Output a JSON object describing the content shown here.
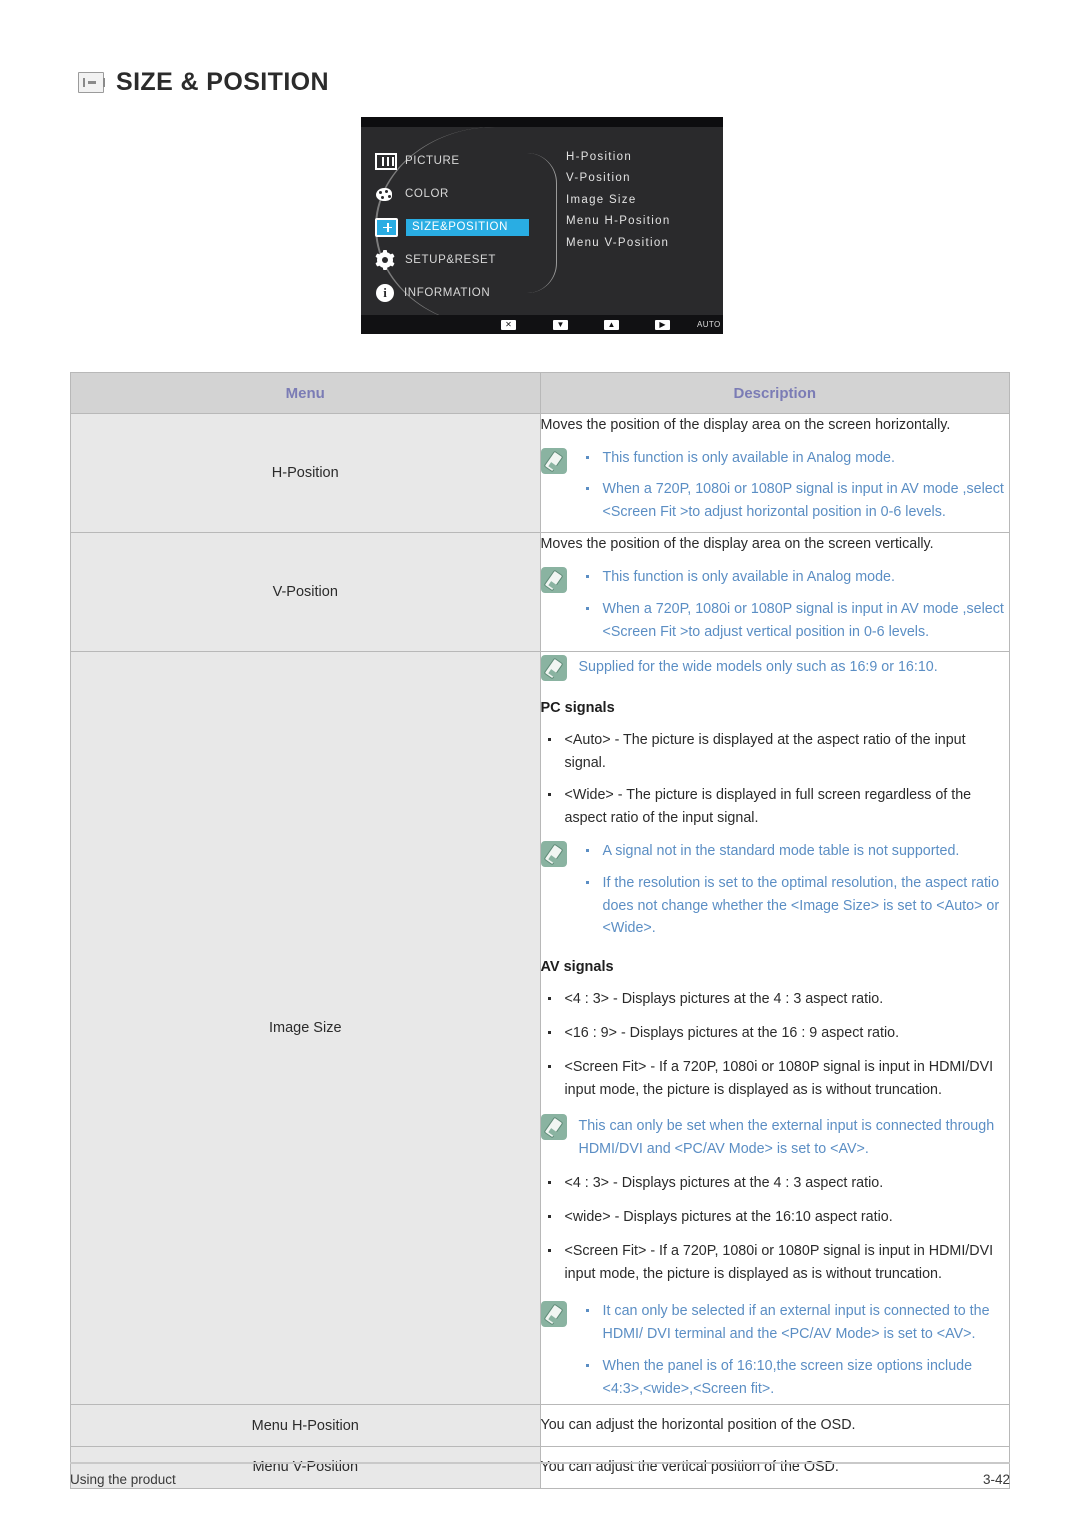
{
  "page": {
    "title": "SIZE & POSITION",
    "title_icon": "size-position-icon"
  },
  "osd": {
    "left_menu": [
      {
        "label": "PICTURE",
        "icon": "picture-icon",
        "selected": false
      },
      {
        "label": "COLOR",
        "icon": "color-palette-icon",
        "selected": false
      },
      {
        "label": "SIZE&POSITION",
        "icon": "size-position-icon",
        "selected": true
      },
      {
        "label": "SETUP&RESET",
        "icon": "gear-icon",
        "selected": false
      },
      {
        "label": "INFORMATION",
        "icon": "info-icon",
        "selected": false
      }
    ],
    "submenu": [
      "H-Position",
      "V-Position",
      "Image Size",
      "Menu H-Position",
      "Menu V-Position"
    ],
    "buttons": [
      {
        "glyph": "✕",
        "name": "exit-button"
      },
      {
        "glyph": "▼",
        "name": "down-button"
      },
      {
        "glyph": "▲",
        "name": "up-button"
      },
      {
        "glyph": "▶",
        "name": "enter-button"
      }
    ],
    "auto_label": "AUTO",
    "power_glyph": "⏻",
    "highlight_color": "#29ade3"
  },
  "table": {
    "headers": {
      "menu": "Menu",
      "description": "Description"
    },
    "rows": {
      "h_position": {
        "menu": "H-Position",
        "intro": "Moves the position of the display area on the screen horizontally.",
        "notes": [
          "This function is only available in Analog mode.",
          "When a 720P, 1080i or 1080P signal is input in AV mode ,select <Screen Fit  >to adjust horizontal position in 0-6 levels."
        ]
      },
      "v_position": {
        "menu": "V-Position",
        "intro": "Moves the position of the display area on the screen vertically.",
        "notes": [
          "This function is only available in Analog mode.",
          "When a 720P, 1080i or 1080P signal is input in AV mode ,select <Screen Fit  >to adjust vertical position in 0-6 levels."
        ]
      },
      "image_size": {
        "menu": "Image Size",
        "note_top": "Supplied for the wide models only such as 16:9 or 16:10.",
        "pc_heading": "PC signals",
        "pc_bullets": [
          "<Auto> - The picture is displayed at the aspect ratio of the input signal.",
          "<Wide> - The picture is displayed in full screen regardless of the aspect ratio of the input signal."
        ],
        "pc_notes": [
          "A signal not in the standard mode table is not supported.",
          "If the resolution is set to the optimal resolution, the aspect ratio does not change whether the <Image Size> is set to <Auto> or <Wide>."
        ],
        "av_heading": "AV signals",
        "av_bullets": [
          "<4 : 3> - Displays pictures at the 4 : 3 aspect ratio.",
          "<16 : 9> - Displays pictures at the 16 : 9 aspect ratio.",
          "<Screen Fit> - If a 720P, 1080i or 1080P signal is input in HDMI/DVI input mode, the picture is displayed as is without truncation."
        ],
        "av_note": "This can only be set when the external input is connected through HDMI/DVI and <PC/AV Mode> is set to <AV>.",
        "av_bullets2": [
          "<4 : 3> - Displays pictures at the 4 : 3 aspect ratio.",
          "<wide> - Displays pictures at the 16:10 aspect ratio.",
          "<Screen Fit> - If a 720P, 1080i or 1080P signal is input in HDMI/DVI input mode, the picture is displayed as is without truncation."
        ],
        "final_notes": [
          "It can only be selected if an external input is connected to the HDMI/ DVI terminal and the <PC/AV Mode> is set to <AV>.",
          "When the panel is of 16:10,the screen size options include <4:3>,<wide>,<Screen fit>."
        ]
      },
      "menu_h_position": {
        "menu": "Menu H-Position",
        "text": "You can adjust the horizontal position of the OSD."
      },
      "menu_v_position": {
        "menu": "Menu V-Position",
        "text": "You can adjust the vertical position of the OSD."
      }
    }
  },
  "footer": {
    "left": "Using the product",
    "right": "3-42"
  }
}
